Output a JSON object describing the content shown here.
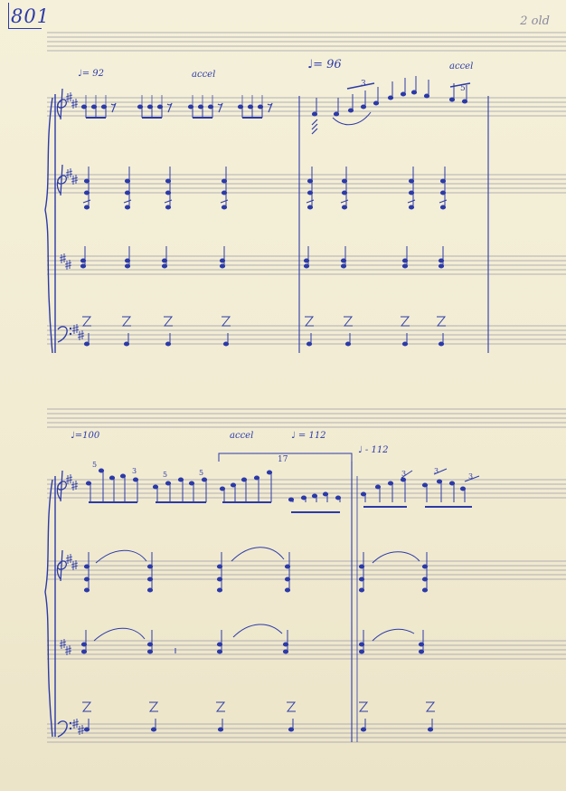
{
  "page": {
    "number": "801",
    "corner_note": "2 old"
  },
  "system1": {
    "tempo_a": "♩= 92",
    "accel_a": "accel",
    "tempo_b": "♩= 96",
    "accel_b": "accel",
    "tuplets": [
      "3",
      "5"
    ]
  },
  "system2": {
    "tempo_a": "♩=100",
    "accel_a": "accel",
    "tempo_b": "♩ = 112",
    "tempo_c": "♩ - 112",
    "tuplets": [
      "5",
      "3",
      "5",
      "5",
      "17",
      "3",
      "3",
      "3"
    ]
  },
  "colors": {
    "ink": "#2c3aa8",
    "paper": "#f3edd5",
    "staff_line": "#9c9ba8"
  }
}
